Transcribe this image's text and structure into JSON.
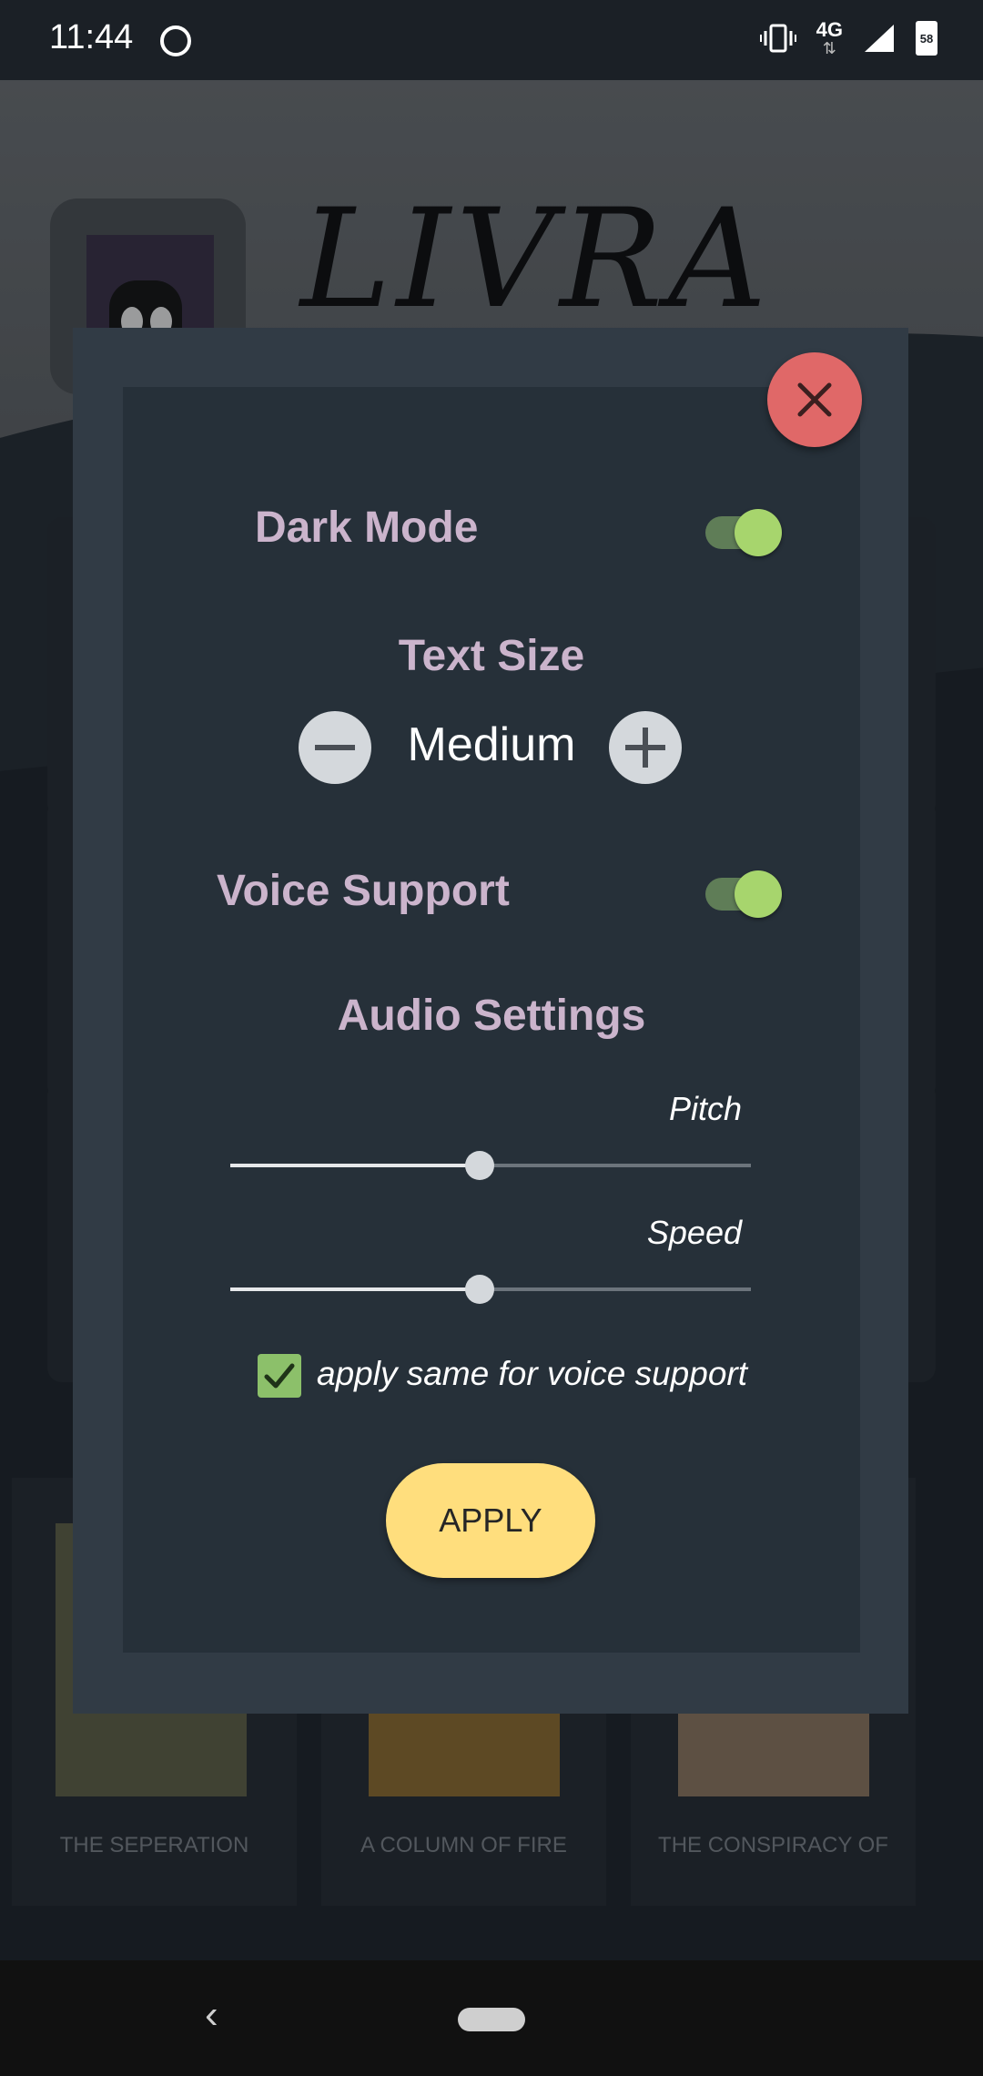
{
  "status_bar": {
    "time": "11:44",
    "network": "4G",
    "battery_level": "58"
  },
  "background": {
    "app_title": "LIVRA",
    "books": [
      {
        "title": "THE SEPERATION"
      },
      {
        "title": "A COLUMN OF FIRE"
      },
      {
        "title": "THE CONSPIRACY OF"
      }
    ]
  },
  "dialog": {
    "dark_mode": {
      "label": "Dark Mode",
      "enabled": true
    },
    "text_size": {
      "label": "Text Size",
      "value": "Medium"
    },
    "voice_support": {
      "label": "Voice Support",
      "enabled": true
    },
    "audio_settings": {
      "label": "Audio Settings",
      "pitch": {
        "label": "Pitch",
        "value": 0.48
      },
      "speed": {
        "label": "Speed",
        "value": 0.48
      }
    },
    "apply_same": {
      "label": "apply same for voice support",
      "checked": true
    },
    "apply_button": "APPLY"
  },
  "colors": {
    "accent_toggle": "#a7d56d",
    "close_button": "#e06868",
    "apply_button": "#ffde7d",
    "label": "#cbb4cc"
  }
}
